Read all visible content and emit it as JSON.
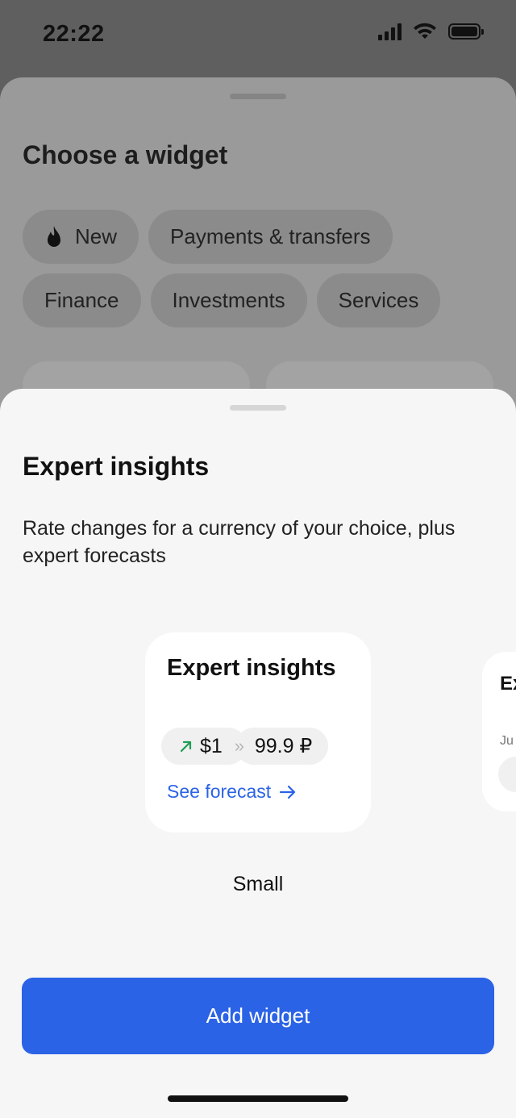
{
  "status_bar": {
    "time": "22:22"
  },
  "background_sheet": {
    "title": "Choose a widget",
    "chips": [
      {
        "label": "New",
        "icon": "fire-icon"
      },
      {
        "label": "Payments & transfers"
      },
      {
        "label": "Finance"
      },
      {
        "label": "Investments"
      },
      {
        "label": "Services"
      }
    ]
  },
  "sheet": {
    "title": "Expert insights",
    "description": "Rate changes for a currency of your choice, plus expert forecasts",
    "widget_preview": {
      "title": "Expert insights",
      "from_amount": "$1",
      "to_amount": "99.9 ₽",
      "link_label": "See forecast",
      "trend_color": "#1f9d55"
    },
    "next_preview": {
      "title": "Ex",
      "subtitle": "Ju"
    },
    "size_label": "Small",
    "add_button_label": "Add widget"
  },
  "colors": {
    "accent": "#2b63e6"
  }
}
